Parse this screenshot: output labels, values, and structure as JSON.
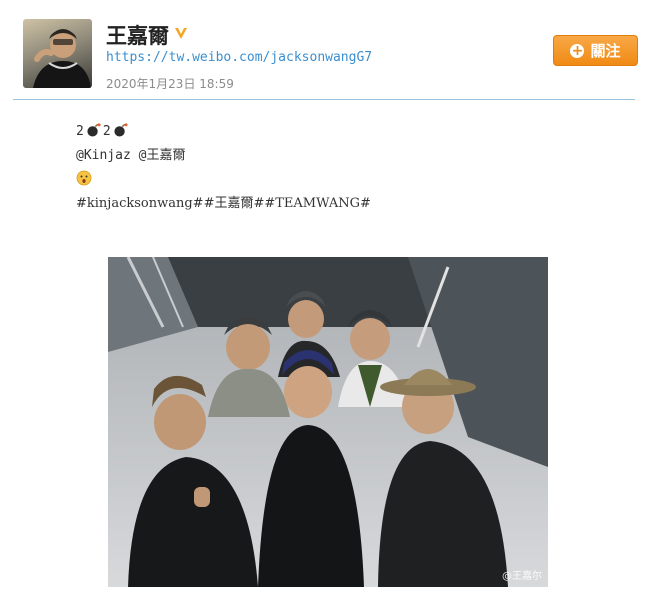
{
  "user": {
    "name": "王嘉爾",
    "profile_url": "https://tw.weibo.com/jacksonwangG7",
    "timestamp": "2020年1月23日 18:59",
    "follow_label": "關注",
    "verified_icon": "verified-v-icon"
  },
  "post": {
    "line1_a": "2",
    "line1_b": "2",
    "line2": "@Kinjaz @王嘉爾",
    "line4": "#kinjacksonwang##王嘉爾##TEAMWANG#",
    "icons": [
      "bomb-emoji-icon",
      "bomb-emoji-icon",
      "surprised-face-emoji-icon"
    ]
  },
  "photo": {
    "watermark": "@王嘉尔"
  },
  "colors": {
    "accent": "#f08a14",
    "link": "#3b8fd0",
    "divider": "#9cc4dd"
  }
}
